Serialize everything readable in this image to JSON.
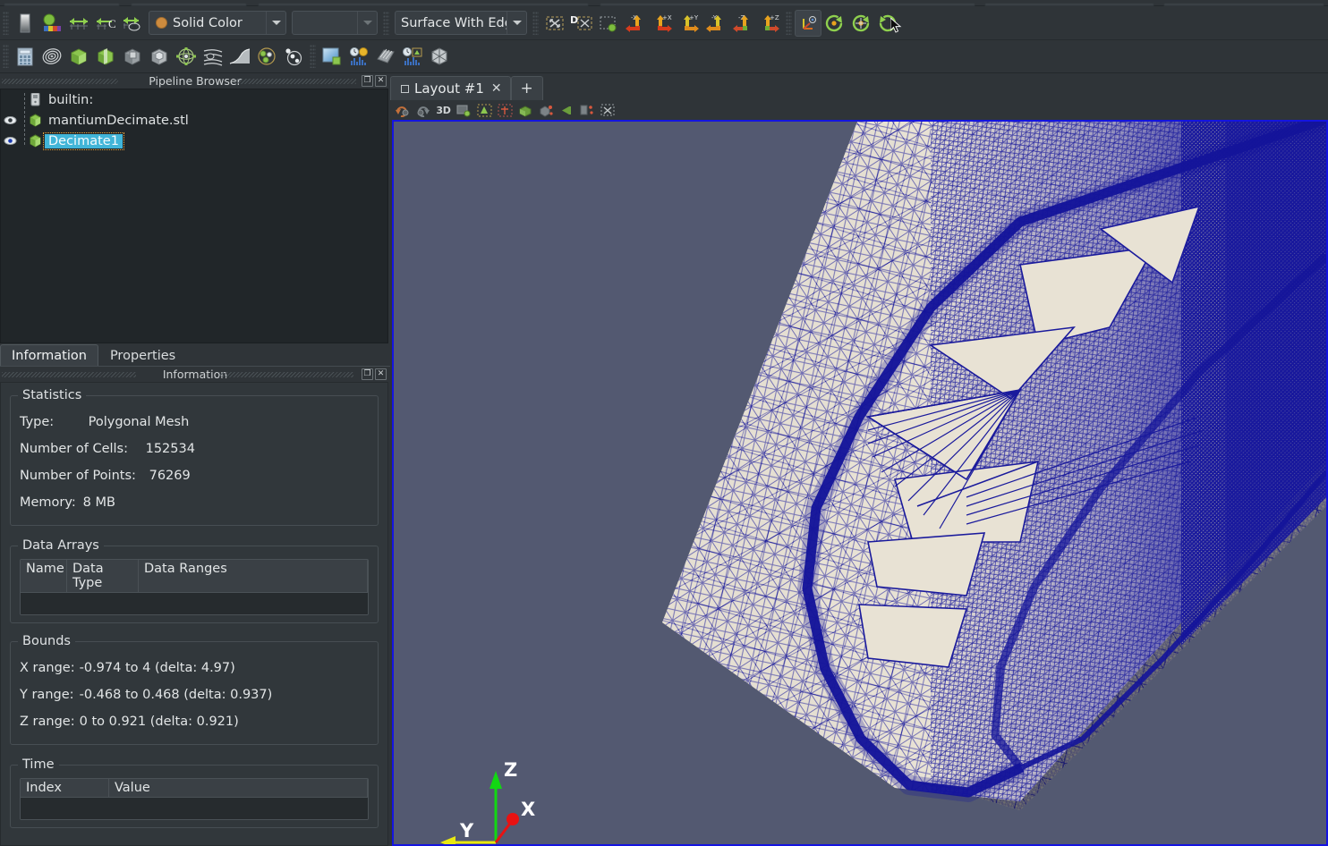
{
  "app": {
    "name": "ParaView",
    "theme_bg": "#2f3438",
    "panel_bg": "#31373b",
    "tree_bg": "#212629"
  },
  "toolbar": {
    "color_by": {
      "value": "Solid Color",
      "swatch_color": "#cd8b3e",
      "arrow_icon": "chevron-down-icon"
    },
    "color_array_component": {
      "value": "",
      "placeholder": ""
    },
    "representation": {
      "value": "Surface With Edge",
      "full_value": "Surface With Edges"
    },
    "buttons_row1_left": [
      {
        "name": "edit-color-map-button",
        "icon": "color-legend-icon"
      },
      {
        "name": "rescale-to-data-range-button",
        "icon": "rescale-data-icon"
      },
      {
        "name": "rescale-to-custom-range-button",
        "icon": "rescale-custom-icon"
      },
      {
        "name": "rescale-to-data-over-time-button",
        "icon": "rescale-time-icon"
      },
      {
        "name": "rescale-visible-range-button",
        "icon": "rescale-visible-icon"
      }
    ],
    "camera_buttons": [
      {
        "name": "reset-camera-button",
        "icon": "reset-camera-icon"
      },
      {
        "name": "zoom-to-data-button",
        "icon": "zoom-to-data-icon"
      },
      {
        "name": "zoom-closest-to-data-button",
        "icon": "zoom-closest-icon"
      },
      {
        "name": "set-view-direction-neg-x-button",
        "icon": "axis-neg-x-icon"
      },
      {
        "name": "set-view-direction-pos-x-button",
        "icon": "axis-pos-x-icon"
      },
      {
        "name": "set-view-direction-pos-y-button",
        "icon": "axis-pos-y-icon"
      },
      {
        "name": "set-view-direction-neg-y-button",
        "icon": "axis-neg-y-icon"
      },
      {
        "name": "set-view-direction-neg-z-button",
        "icon": "axis-neg-z-icon"
      },
      {
        "name": "set-view-direction-pos-z-button",
        "icon": "axis-pos-z-icon"
      }
    ],
    "rotate_buttons": [
      {
        "name": "show-center-of-rotation-button",
        "icon": "center-axes-icon",
        "selected": true
      },
      {
        "name": "rotate-90-ccw-button",
        "icon": "rotate-ccw-icon"
      },
      {
        "name": "pick-center-of-rotation-button",
        "icon": "rotate-center-icon"
      },
      {
        "name": "rotate-90-cw-button",
        "icon": "rotate-cw-icon"
      }
    ],
    "filters_row": [
      {
        "name": "calculator-filter-button",
        "icon": "calculator-icon"
      },
      {
        "name": "contour-filter-button",
        "icon": "contour-icon"
      },
      {
        "name": "clip-filter-button",
        "icon": "clip-icon"
      },
      {
        "name": "slice-filter-button",
        "icon": "slice-icon"
      },
      {
        "name": "threshold-filter-button",
        "icon": "threshold-icon"
      },
      {
        "name": "extract-subset-filter-button",
        "icon": "extract-subset-icon"
      },
      {
        "name": "glyph-filter-button",
        "icon": "glyph-icon"
      },
      {
        "name": "stream-tracer-filter-button",
        "icon": "stream-tracer-icon"
      },
      {
        "name": "warp-filter-button",
        "icon": "warp-icon"
      },
      {
        "name": "group-datasets-filter-button",
        "icon": "group-datasets-icon"
      },
      {
        "name": "extract-level-filter-button",
        "icon": "extract-level-icon"
      }
    ],
    "view_row": [
      {
        "name": "render-view-button",
        "icon": "render-view-icon"
      },
      {
        "name": "line-chart-view-button",
        "icon": "line-chart-icon"
      },
      {
        "name": "slice-view-button",
        "icon": "slice-view-icon"
      },
      {
        "name": "plot-over-time-button",
        "icon": "plot-time-icon"
      },
      {
        "name": "axes-grid-button",
        "icon": "axes-grid-icon"
      }
    ]
  },
  "pipeline": {
    "title": "Pipeline Browser",
    "undock_icon": "undock-icon",
    "close_icon": "close-icon",
    "items": [
      {
        "label": "builtin:",
        "icon": "server-icon",
        "indent": 0,
        "has_eye": false,
        "selected": false,
        "visible": false
      },
      {
        "label": "mantiumDecimate.stl",
        "icon": "geometry-green-icon",
        "indent": 1,
        "has_eye": true,
        "selected": false,
        "visible": true
      },
      {
        "label": "Decimate1",
        "icon": "geometry-green-icon",
        "indent": 1,
        "has_eye": true,
        "selected": true,
        "visible": true
      }
    ]
  },
  "panel_tabs": [
    {
      "label": "Information",
      "active": true,
      "name": "tab-information"
    },
    {
      "label": "Properties",
      "active": false,
      "name": "tab-properties"
    }
  ],
  "information": {
    "title": "Information",
    "undock_icon": "undock-icon",
    "close_icon": "close-icon",
    "statistics": {
      "legend": "Statistics",
      "rows": [
        {
          "key": "Type:",
          "value": "Polygonal Mesh"
        },
        {
          "key": "Number of Cells:",
          "value": "152534"
        },
        {
          "key": "Number of Points:",
          "value": "76269"
        },
        {
          "key": "Memory:",
          "value": "8 MB"
        }
      ]
    },
    "data_arrays": {
      "legend": "Data Arrays",
      "columns": [
        "Name",
        "Data Type",
        "Data Ranges"
      ],
      "rows": []
    },
    "bounds": {
      "legend": "Bounds",
      "rows": [
        {
          "key": "X range:",
          "value": "-0.974 to 4 (delta: 4.97)"
        },
        {
          "key": "Y range:",
          "value": "-0.468 to 0.468 (delta: 0.937)"
        },
        {
          "key": "Z range:",
          "value": "0 to 0.921 (delta: 0.921)"
        }
      ]
    },
    "time": {
      "legend": "Time",
      "columns": [
        "Index",
        "Value"
      ],
      "rows": []
    }
  },
  "annotation": {
    "type": "highlighter-stroke",
    "color": "#45c2f0",
    "note": "cyan highlighter underline beneath Memory row"
  },
  "layout": {
    "tabs": [
      {
        "label": "Layout #1",
        "active": true,
        "close_icon": "close-icon",
        "name": "layout-tab-1"
      },
      {
        "label": "+",
        "active": false,
        "name": "new-layout-tab"
      }
    ],
    "view_toolbar": [
      {
        "name": "undo-camera-button",
        "icon": "undo-camera-icon"
      },
      {
        "name": "redo-camera-button",
        "icon": "redo-camera-icon"
      },
      {
        "name": "toggle-2d-3d-button",
        "icon": "3d-toggle-icon",
        "label": "3D"
      },
      {
        "name": "camera-link-button",
        "icon": "camera-link-icon"
      },
      {
        "name": "show-orientation-axes-button",
        "icon": "orientation-axes-icon"
      },
      {
        "name": "show-center-axes-button",
        "icon": "center-axes-icon"
      },
      {
        "name": "reset-center-button",
        "icon": "reset-center-icon"
      },
      {
        "name": "pick-center-button",
        "icon": "pick-center-icon"
      },
      {
        "name": "back-button",
        "icon": "back-arrow-icon"
      },
      {
        "name": "split-horizontal-button",
        "icon": "split-horizontal-icon"
      },
      {
        "name": "split-vertical-button",
        "icon": "split-vertical-icon"
      }
    ]
  },
  "render_view": {
    "background_color": "#535971",
    "surface_color": "#e8e2d4",
    "edge_color": "#1a1a9c",
    "active_border_color": "#1414e0",
    "orientation_axes": {
      "x_label": "X",
      "x_color": "#e81212",
      "y_label": "Y",
      "y_color": "#e8e812",
      "z_label": "Z",
      "z_color": "#12d812"
    }
  }
}
